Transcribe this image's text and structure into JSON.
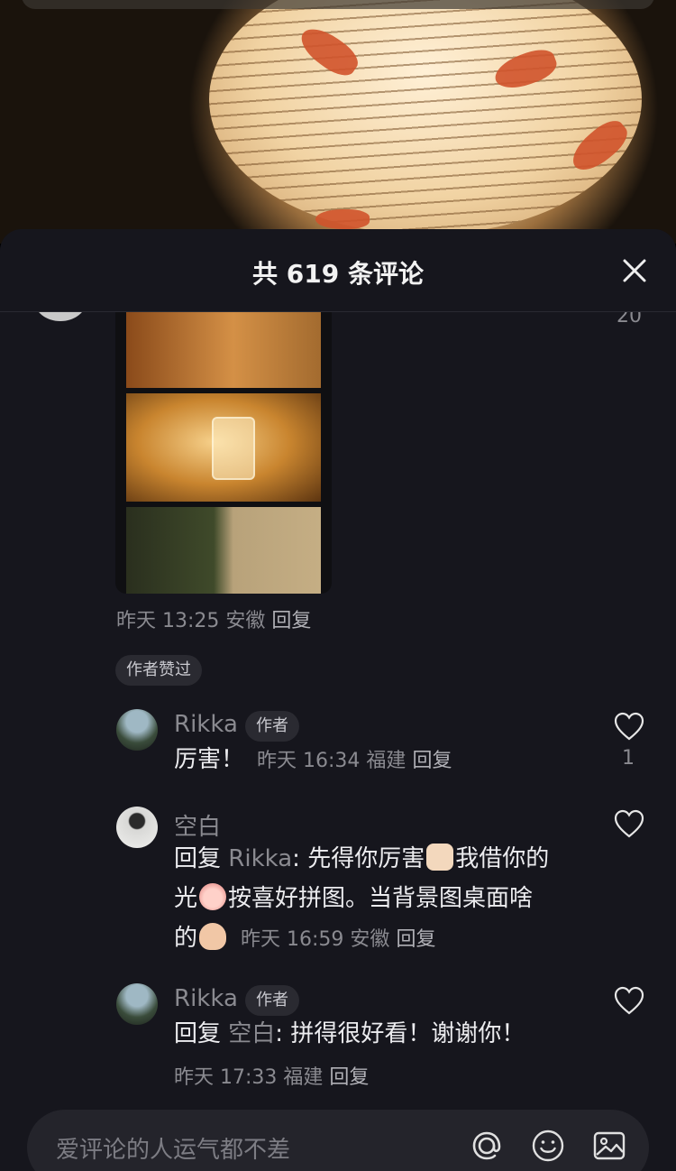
{
  "sheet": {
    "title": "共 619 条评论"
  },
  "top_comment": {
    "like_count": "20",
    "time": "昨天 13:25",
    "location": "安徽",
    "reply_label": "回复",
    "author_liked_badge": "作者赞过"
  },
  "replies": [
    {
      "name": "Rikka",
      "badge": "作者",
      "text": "厉害！",
      "time": "昨天 16:34",
      "location": "福建",
      "reply_label": "回复",
      "like_count": "1"
    },
    {
      "name": "空白",
      "reply_prefix": "回复",
      "reply_target": "Rikka",
      "text_part1": ": 先得你厉害",
      "text_part2": "我借你的",
      "text_part3": "光",
      "text_part4": "按喜好拼图。当背景图桌面啥",
      "text_part5": "的",
      "time": "昨天 16:59",
      "location": "安徽",
      "reply_label": "回复"
    },
    {
      "name": "Rikka",
      "badge": "作者",
      "reply_prefix": "回复",
      "reply_target": "空白",
      "text": ": 拼得很好看！谢谢你！",
      "time": "昨天 17:33",
      "location": "福建",
      "reply_label": "回复"
    }
  ],
  "input": {
    "placeholder": "爱评论的人运气都不差"
  },
  "icons": {
    "close": "close-icon",
    "heart": "heart-icon",
    "at": "at-icon",
    "emoji": "emoji-icon",
    "image": "image-icon"
  }
}
